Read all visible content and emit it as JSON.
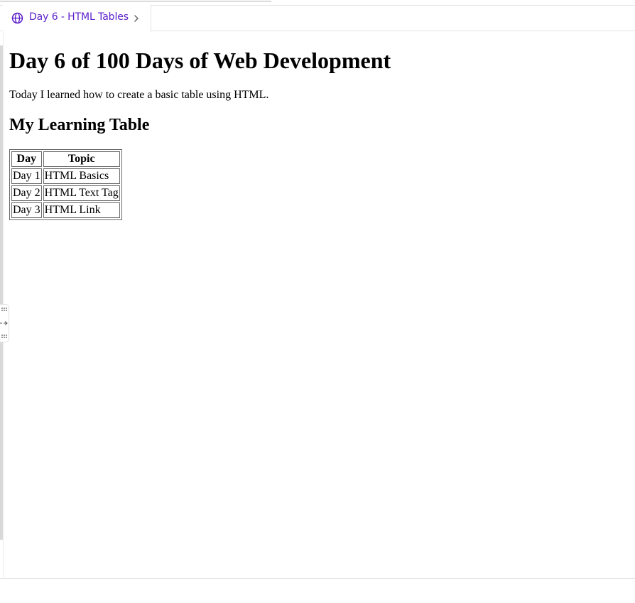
{
  "tab": {
    "label": "Day 6 - HTML Tables",
    "icon": "globe-icon",
    "chevron_icon": "chevron-right-icon",
    "accent": "#5b1fc9"
  },
  "page": {
    "title": "Day 6 of 100 Days of Web Development",
    "intro": "Today I learned how to create a basic table using HTML.",
    "table_heading": "My Learning Table"
  },
  "table": {
    "headers": [
      "Day",
      "Topic"
    ],
    "rows": [
      [
        "Day 1",
        "HTML Basics"
      ],
      [
        "Day 2",
        "HTML Text Tag"
      ],
      [
        "Day 3",
        "HTML Link"
      ]
    ]
  }
}
